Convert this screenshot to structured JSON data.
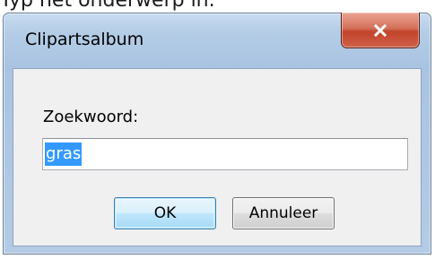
{
  "background_text": "Typ het onderwerp in.",
  "dialog": {
    "title": "Clipartsalbum",
    "close_icon": "close-icon",
    "search_label": "Zoekwoord:",
    "search_value": "gras",
    "ok_label": "OK",
    "cancel_label": "Annuleer"
  },
  "colors": {
    "selection": "#3399ff",
    "close_button": "#c2442b",
    "default_button_border": "#3c7fb1"
  }
}
